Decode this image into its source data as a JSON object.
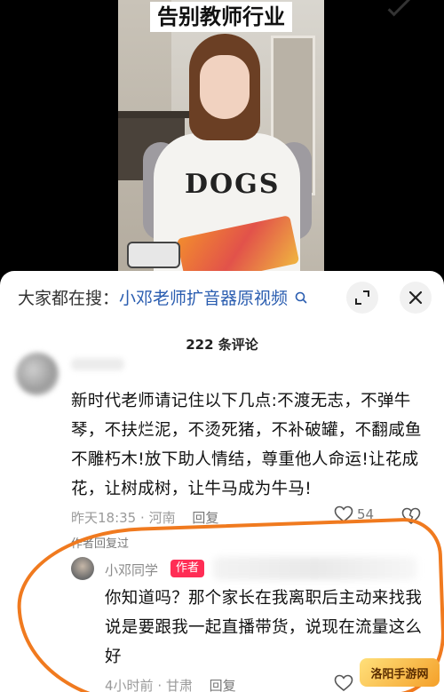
{
  "video": {
    "title_banner": "告别教师行业",
    "shirt_print": "DOGS"
  },
  "search": {
    "prefix": "大家都在搜：",
    "query": "小邓老师扩音器原视频",
    "go_icon": "search-arrow-icon",
    "collapse_icon": "collapse-icon",
    "close_icon": "close-icon"
  },
  "comments": {
    "count_label": "222 条评论",
    "items": [
      {
        "text": "新时代老师请记住以下几点:不渡无志，不弹牛琴，不扶烂泥，不烫死猪，不补破罐，不翻咸鱼不雕朽木!放下助人情结，尊重他人命运!让花成花，让树成树，让牛马成为牛马!",
        "time": "昨天18:35",
        "location": "河南",
        "reply_label": "回复",
        "likes": "54",
        "author_replied": "作者回复过"
      },
      {
        "author": "小邓同学",
        "badge": "作者",
        "text": "你知道吗？那个家长在我离职后主动来找我说是要跟我一起直播带货，说现在流量这么好",
        "time": "4小时前",
        "location": "甘肃",
        "reply_label": "回复"
      }
    ]
  },
  "watermark": {
    "text": "洛阳手游网"
  },
  "colors": {
    "query_blue": "#2a5db0",
    "author_badge": "#ff2d55",
    "highlight_orange": "#f07a1f"
  }
}
